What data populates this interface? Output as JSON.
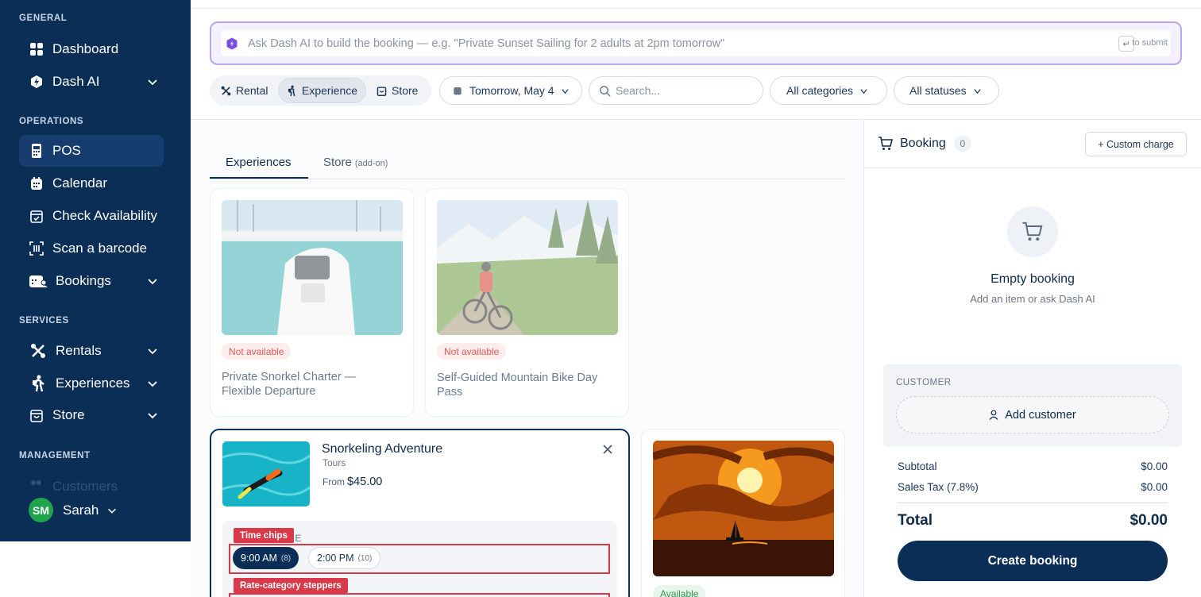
{
  "sidebar": {
    "sections": {
      "general": "GENERAL",
      "operations": "OPERATIONS",
      "services": "SERVICES",
      "management": "MANAGEMENT"
    },
    "items": {
      "dashboard": "Dashboard",
      "dash_ai": "Dash AI",
      "pos": "POS",
      "calendar": "Calendar",
      "check_availability": "Check Availability",
      "scan_barcode": "Scan a barcode",
      "bookings": "Bookings",
      "rentals": "Rentals",
      "experiences": "Experiences",
      "store": "Store",
      "customers": "Customers"
    },
    "user": {
      "initials": "SM",
      "name": "Sarah",
      "avatar_color": "#1fa44a"
    }
  },
  "ai_bar": {
    "placeholder": "Ask Dash AI to build the booking — e.g. \"Private Sunset Sailing for 2 adults at 2pm tomorrow\"",
    "key_hint": "↵",
    "submit_hint": "to submit"
  },
  "toolbar": {
    "modes": [
      "Rental",
      "Experience",
      "Store"
    ],
    "active_mode": "Experience",
    "date": "Tomorrow, May 4",
    "search_placeholder": "Search...",
    "categories": "All categories",
    "statuses": "All statuses"
  },
  "tabs": {
    "experiences": "Experiences",
    "store": "Store",
    "store_note": "(add-on)"
  },
  "cards": [
    {
      "title": "Private Snorkel Charter — Flexible Departure",
      "status": "Not available",
      "icon": "boat-photo"
    },
    {
      "title": "Self-Guided Mountain Bike Day Pass",
      "status": "Not available",
      "icon": "mountain-bike-photo"
    }
  ],
  "selected": {
    "title": "Snorkeling Adventure",
    "category": "Tours",
    "from_label": "From",
    "price": "$45.00",
    "time_label_partial": "IME",
    "time_chips_label": "Time chips",
    "rate_label": "Rate-category steppers",
    "times": [
      {
        "label": "9:00 AM",
        "count": "(8)",
        "selected": true
      },
      {
        "label": "2:00 PM",
        "count": "(10)",
        "selected": false
      }
    ]
  },
  "card4": {
    "status": "Available",
    "icon": "sunset-sailing-photo"
  },
  "booking": {
    "title": "Booking",
    "count": "0",
    "custom_charge": "+ Custom charge",
    "empty_title": "Empty booking",
    "empty_sub": "Add an item or ask Dash AI",
    "customer_label": "CUSTOMER",
    "add_customer": "Add customer",
    "subtotal_label": "Subtotal",
    "subtotal": "$0.00",
    "tax_label": "Sales Tax (7.8%)",
    "tax": "$0.00",
    "total_label": "Total",
    "total": "$0.00",
    "create": "Create booking"
  },
  "colors": {
    "navy": "#0b2e57",
    "ai_border": "#b8a6ee",
    "highlight": "#d83a4a",
    "available": "#2a9a4e",
    "unavailable": "#e15a5a"
  }
}
